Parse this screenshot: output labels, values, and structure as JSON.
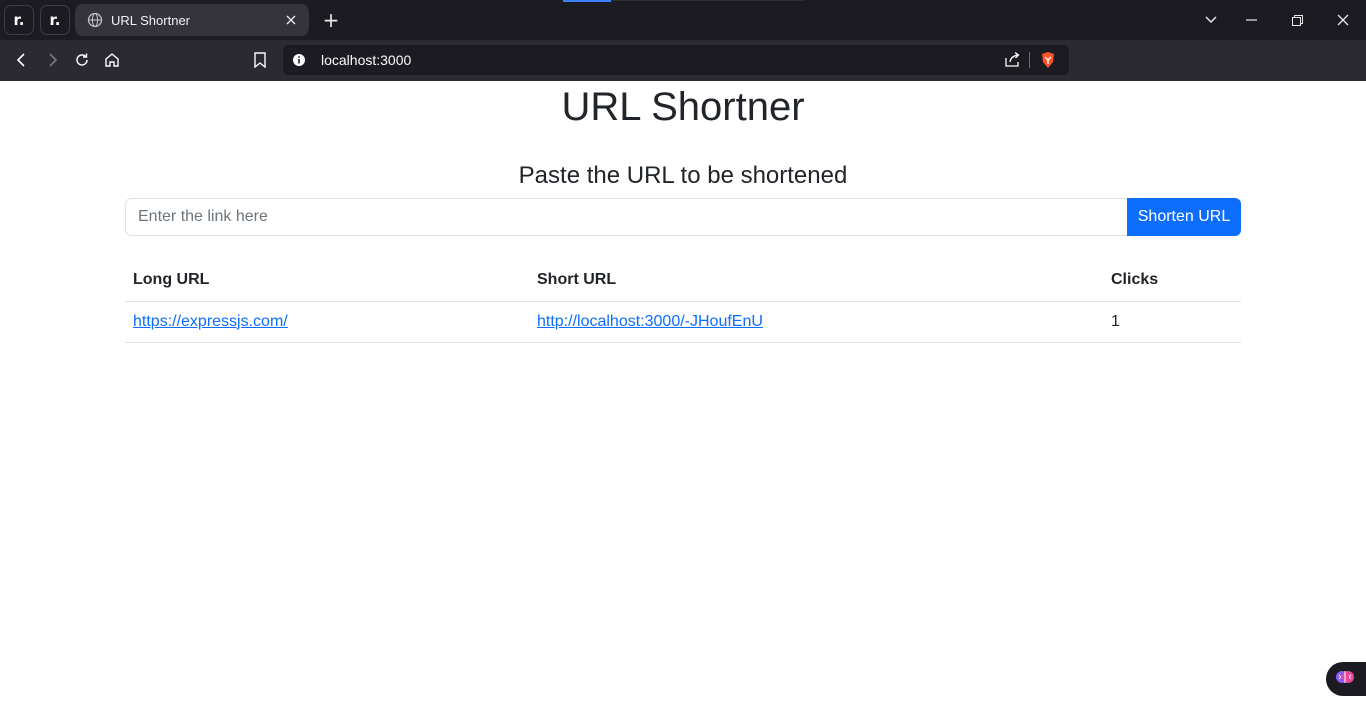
{
  "browser": {
    "pinned_tabs": [
      {
        "label": "r."
      },
      {
        "label": "r."
      }
    ],
    "tab": {
      "title": "URL Shortner"
    },
    "new_tab_label": "+",
    "address": "localhost:3000"
  },
  "page": {
    "title": "URL Shortner",
    "subtitle": "Paste the URL to be shortened",
    "input_placeholder": "Enter the link here",
    "button_label": "Shorten URL",
    "table": {
      "headers": [
        "Long URL",
        "Short URL",
        "Clicks"
      ],
      "rows": [
        {
          "long_url": "https://expressjs.com/",
          "short_url": "http://localhost:3000/-JHoufEnU",
          "clicks": "1"
        }
      ]
    }
  },
  "colors": {
    "accent": "#0d6efd",
    "tab_bg": "#35343d",
    "toolbar_bg": "#2b2a33",
    "tabstrip_bg": "#1c1b22"
  }
}
